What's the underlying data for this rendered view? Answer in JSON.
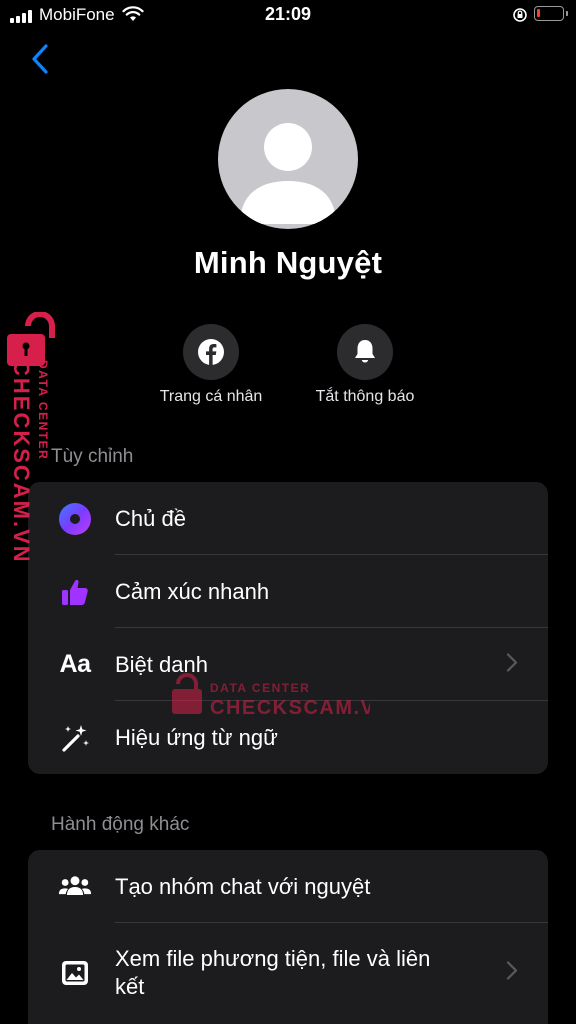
{
  "status_bar": {
    "carrier": "MobiFone",
    "time": "21:09",
    "battery_level": 0.12
  },
  "profile": {
    "name": "Minh Nguyệt"
  },
  "actions": [
    {
      "label": "Trang cá nhân",
      "icon": "facebook-icon"
    },
    {
      "label": "Tắt thông báo",
      "icon": "bell-icon"
    }
  ],
  "sections": {
    "customize": {
      "title": "Tùy chỉnh",
      "items": [
        {
          "label": "Chủ đề",
          "icon": "theme-icon"
        },
        {
          "label": "Cảm xúc nhanh",
          "icon": "thumbs-up-icon"
        },
        {
          "label": "Biệt danh",
          "icon": "nickname-icon",
          "icon_text": "Aa"
        },
        {
          "label": "Hiệu ứng từ ngữ",
          "icon": "magic-wand-icon"
        }
      ]
    },
    "other_actions": {
      "title": "Hành động khác",
      "items": [
        {
          "label": "Tạo nhóm chat với nguyệt",
          "icon": "group-icon"
        },
        {
          "label": "Xem file phương tiện, file và liên kết",
          "icon": "image-icon"
        }
      ]
    }
  },
  "watermark": {
    "side_top": "DATA CENTER",
    "side_main": "CHECKSCAM.VN",
    "center_top": "DATA CENTER",
    "center_main": "CHECKSCAM.VN"
  },
  "colors": {
    "background": "#000000",
    "card": "#1c1c1e",
    "accent_blue": "#0a84ff",
    "thumb_purple": "#a033ff",
    "watermark_red": "#d6204b"
  }
}
